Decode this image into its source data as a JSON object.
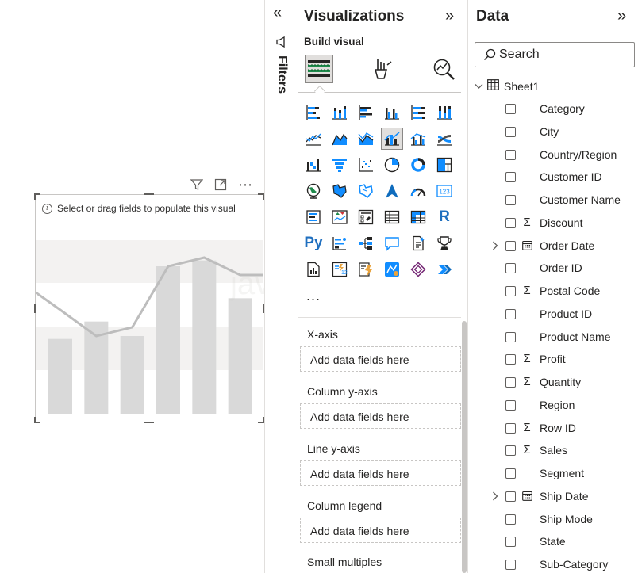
{
  "canvas": {
    "hint": "Select or drag fields to populate this visual",
    "header_icons": [
      "filter-icon",
      "focus-mode-icon",
      "more-options-icon"
    ],
    "more_options": "⋯"
  },
  "placeholder_chart": {
    "type": "bar",
    "bar_values": [
      2.6,
      3.2,
      2.7,
      5.1,
      5.3,
      4.0
    ],
    "line_values": [
      3.6,
      2.7,
      3.0,
      5.1,
      5.4,
      4.8
    ],
    "ylim": [
      0,
      6
    ],
    "colors": {
      "bar": "#d9d9d9",
      "line": "#bdbdbd",
      "band": "#f3f2f1"
    }
  },
  "filters": {
    "label": "Filters",
    "collapse_glyph": "«"
  },
  "visualizations": {
    "title": "Visualizations",
    "expand_glyph": "»",
    "build_label": "Build visual",
    "tabs": [
      "build-visual-icon",
      "format-visual-icon",
      "analytics-icon"
    ],
    "more": "...",
    "r_label": "R",
    "py_label": "Py",
    "wells": [
      {
        "label": "X-axis",
        "placeholder": "Add data fields here"
      },
      {
        "label": "Column y-axis",
        "placeholder": "Add data fields here"
      },
      {
        "label": "Line y-axis",
        "placeholder": "Add data fields here"
      },
      {
        "label": "Column legend",
        "placeholder": "Add data fields here"
      },
      {
        "label": "Small multiples"
      }
    ]
  },
  "data": {
    "title": "Data",
    "expand_glyph": "»",
    "search_placeholder": "Search",
    "table_name": "Sheet1",
    "fields": [
      {
        "name": "Category",
        "type": "text"
      },
      {
        "name": "City",
        "type": "text"
      },
      {
        "name": "Country/Region",
        "type": "text"
      },
      {
        "name": "Customer ID",
        "type": "text"
      },
      {
        "name": "Customer Name",
        "type": "text"
      },
      {
        "name": "Discount",
        "type": "sum"
      },
      {
        "name": "Order Date",
        "type": "date"
      },
      {
        "name": "Order ID",
        "type": "text"
      },
      {
        "name": "Postal Code",
        "type": "sum"
      },
      {
        "name": "Product ID",
        "type": "text"
      },
      {
        "name": "Product Name",
        "type": "text"
      },
      {
        "name": "Profit",
        "type": "sum"
      },
      {
        "name": "Quantity",
        "type": "sum"
      },
      {
        "name": "Region",
        "type": "text"
      },
      {
        "name": "Row ID",
        "type": "sum"
      },
      {
        "name": "Sales",
        "type": "sum"
      },
      {
        "name": "Segment",
        "type": "text"
      },
      {
        "name": "Ship Date",
        "type": "date"
      },
      {
        "name": "Ship Mode",
        "type": "text"
      },
      {
        "name": "State",
        "type": "text"
      },
      {
        "name": "Sub-Category",
        "type": "text"
      }
    ],
    "sum_glyph": "Σ"
  },
  "watermark": "javatpoint"
}
